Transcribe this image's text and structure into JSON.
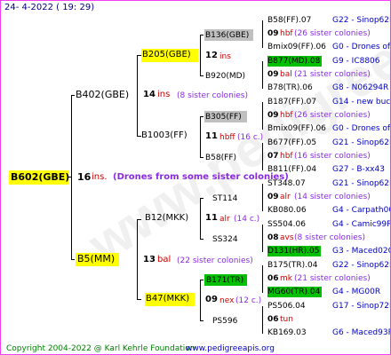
{
  "header": {
    "date_label": "24-  4-2022 ( 19: 29)"
  },
  "watermark": "www.pedigreeapis.org",
  "root": {
    "name": "B602(GBE)",
    "colonies_num": "16",
    "colonies_unit": "ins.",
    "note": "(Drones from some sister colonies)"
  },
  "father": {
    "name": "B402(GBE)",
    "colonies_num": "14",
    "colonies_unit": "ins",
    "note": "(8 sister colonies)"
  },
  "mother": {
    "name": "B5(MM)",
    "colonies_num": "13",
    "colonies_unit": "bal",
    "note": "(22 sister colonies)"
  },
  "gen3": [
    {
      "name": "B205(GBE)",
      "colonies_num": "12",
      "colonies_unit": "ins"
    },
    {
      "name": "B1003(FF)",
      "colonies_num": "11",
      "colonies_unit": "hbff",
      "note": "(16 c.)"
    },
    {
      "name": "B12(MKK)",
      "colonies_num": "11",
      "colonies_unit": "alr",
      "note": "(14 c.)"
    },
    {
      "name": "B47(MKK)",
      "colonies_num": "09",
      "colonies_unit": "nex",
      "note": "(12 c.)"
    }
  ],
  "gen4": [
    {
      "name": "B136(GBE)"
    },
    {
      "name": "B920(MD)"
    },
    {
      "name": "B305(FF)"
    },
    {
      "name": "B58(FF)"
    },
    {
      "name": "ST114"
    },
    {
      "name": "SS324"
    },
    {
      "name": "B171(TR)"
    },
    {
      "name": "PS596"
    }
  ],
  "gen5": [
    {
      "top": "B58(FF).07",
      "top_right": "G22 - Sinop62R",
      "num": "09",
      "unit": "hbf",
      "note": "(26 sister colonies)",
      "bottom": "Bmix09(FF).06",
      "bottom_right": "G0 - Drones of t"
    },
    {
      "top": "B877(MD).08",
      "top_right": "G9 - IC8806",
      "num": "09",
      "unit": "bal",
      "note": "(21 sister colonies)",
      "bottom": "B78(TR).06",
      "bottom_right": "G8 - N06294R"
    },
    {
      "top": "B187(FF).07",
      "top_right": "G14 - new buckfas",
      "num": "09",
      "unit": "hbf",
      "note": "(26 sister colonies)",
      "bottom": "Bmix09(FF).06",
      "bottom_right": "G0 - Drones of t"
    },
    {
      "top": "B677(FF).05",
      "top_right": "G21 - Sinop62R",
      "num": "07",
      "unit": "hbf",
      "note": "(16 sister colonies)",
      "bottom": "B811(FF).04",
      "bottom_right": "G27 - B-xx43"
    },
    {
      "top": "ST348.07",
      "top_right": "G21 - Sinop62R",
      "num": "09",
      "unit": "alr",
      "note": "(14 sister colonies)",
      "bottom": "KB080.06",
      "bottom_right": "G4 - Carpath00R"
    },
    {
      "top": "SS504.06",
      "top_right": "G4 - Camic99R",
      "num": "08",
      "unit": "avs",
      "note": "(8 sister colonies)",
      "bottom": "D131(HR).05",
      "bottom_right": "G3 - Maced02Q"
    },
    {
      "top": "B175(TR).04",
      "top_right": "G22 - Sinop62R",
      "num": "06",
      "unit": "mk",
      "note": "(21 sister colonies)",
      "bottom": "MG60(TR).04",
      "bottom_right": "G4 - MG00R"
    },
    {
      "top": "PS506.04",
      "top_right": "G17 - Sinop72R",
      "num": "06",
      "unit": "tun",
      "note": "",
      "bottom": "KB169.03",
      "bottom_right": "G6 - Maced93R"
    }
  ],
  "footer": {
    "copyright": "Copyright 2004-2022 @ Karl Kehrle Foundation",
    "site": "www.pedigreeapis.org"
  },
  "colors": {
    "yellow_box": "#ffff00",
    "gray_box": "#c0c0c0",
    "green_box": "#00c000",
    "border": "#f040f0",
    "dark_red": "#cc0000",
    "purple": "#8a2be2",
    "blue": "#0000c0",
    "footer_green": "#008000"
  }
}
